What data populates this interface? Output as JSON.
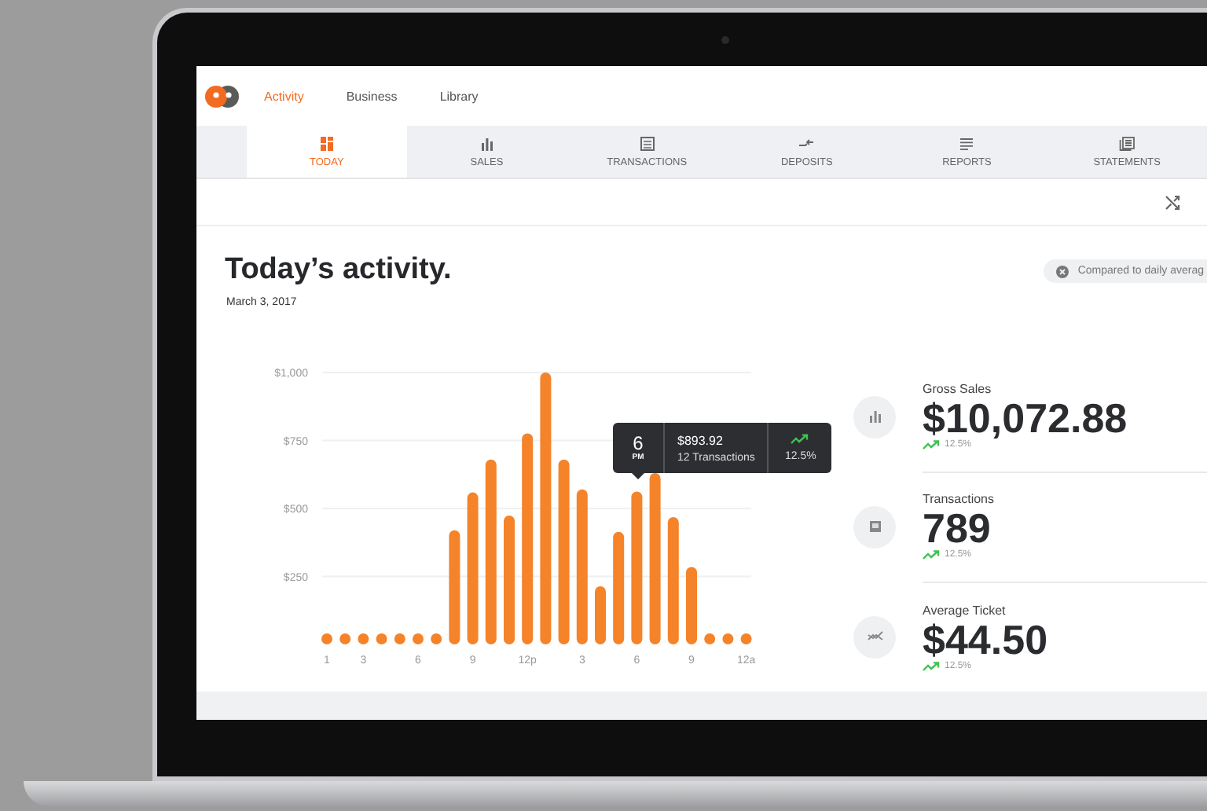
{
  "top_nav": {
    "items": [
      {
        "label": "Activity",
        "selected": true
      },
      {
        "label": "Business",
        "selected": false
      },
      {
        "label": "Library",
        "selected": false
      }
    ]
  },
  "tabs": [
    {
      "label": "TODAY",
      "selected": true
    },
    {
      "label": "SALES",
      "selected": false
    },
    {
      "label": "TRANSACTIONS",
      "selected": false
    },
    {
      "label": "DEPOSITS",
      "selected": false
    },
    {
      "label": "REPORTS",
      "selected": false
    },
    {
      "label": "STATEMENTS",
      "selected": false
    }
  ],
  "heading": {
    "title": "Today’s activity.",
    "date": "March 3, 2017"
  },
  "compare_pill": {
    "label": "Compared to daily averag"
  },
  "chart": {
    "chart_data": {
      "type": "bar",
      "categories": [
        "1",
        null,
        "3",
        null,
        null,
        "6",
        null,
        null,
        "9",
        null,
        null,
        "12p",
        null,
        null,
        "3",
        null,
        null,
        "6",
        null,
        null,
        "9",
        null,
        null,
        "12a"
      ],
      "grid": true,
      "series": [
        {
          "color": "#f5832a",
          "values": [
            40,
            40,
            40,
            40,
            40,
            40,
            40,
            420,
            559,
            680,
            474,
            776,
            1000,
            680,
            570,
            214,
            414,
            562,
            630,
            468,
            285,
            40,
            40,
            40
          ]
        }
      ],
      "ylim": [
        0,
        1000
      ],
      "yticks": [
        {
          "value": 250,
          "label": "$250"
        },
        {
          "value": 500,
          "label": "$500"
        },
        {
          "value": 750,
          "label": "$750"
        },
        {
          "value": 1000,
          "label": "$1,000"
        }
      ]
    },
    "tooltip": {
      "hour": "6",
      "period": "PM",
      "amount": "$893.92",
      "transactions": "12 Transactions",
      "change": "12.5%"
    }
  },
  "stats": [
    {
      "label": "Gross Sales",
      "value": "$10,072.88",
      "change": "12.5%"
    },
    {
      "label": "Transactions",
      "value": "789",
      "change": "12.5%"
    },
    {
      "label": "Average Ticket",
      "value": "$44.50",
      "change": "12.5%"
    }
  ]
}
